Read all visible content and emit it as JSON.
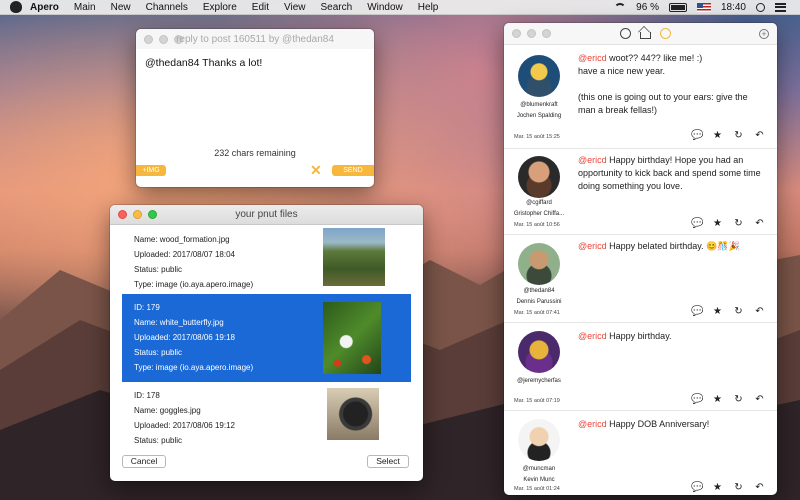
{
  "menubar": {
    "app": "Apero",
    "items": [
      "Main",
      "New",
      "Channels",
      "Explore",
      "Edit",
      "View",
      "Search",
      "Window",
      "Help"
    ],
    "battery": "96 %",
    "clock": "18:40"
  },
  "reply_window": {
    "title": "reply to post 160511 by @thedan84",
    "text": "@thedan84 Thanks a lot!",
    "chars_remaining": "232 chars remaining",
    "img_label": "+IMG",
    "cancel_glyph": "✕",
    "send_label": "SEND",
    "accent": "#f6b73c"
  },
  "files_window": {
    "title": "your pnut files",
    "files": [
      {
        "id": "",
        "name": "Name: wood_formation.jpg",
        "uploaded": "Uploaded: 2017/08/07 18:04",
        "status": "Status: public",
        "type": "Type: image (io.aya.apero.image)"
      },
      {
        "id": "ID: 179",
        "name": "Name: white_butterfly.jpg",
        "uploaded": "Uploaded: 2017/08/06 19:18",
        "status": "Status: public",
        "type": "Type: image (io.aya.apero.image)"
      },
      {
        "id": "ID: 178",
        "name": "Name: goggles.jpg",
        "uploaded": "Uploaded: 2017/08/06 19:12",
        "status": "Status: public",
        "type": ""
      }
    ],
    "selected_color": "#1a69d6",
    "cancel_label": "Cancel",
    "select_label": "Select"
  },
  "timeline": {
    "posts": [
      {
        "mention": "@ericd",
        "text": " woot?? 44?? like me! :)\nhave a nice new year.\n\n(this one is going out to your ears: give the man a break fellas!)",
        "username": "@blumenkraft",
        "fullname": "Jochen Spalding",
        "time": "Mar. 15 août 15:25"
      },
      {
        "mention": "@ericd",
        "text": " Happy birthday! Hope you had an opportunity to kick back and spend some time doing something you love.",
        "username": "@cgiffard",
        "fullname": "Gristopher Chiffa...",
        "time": "Mar. 15 août 10:56"
      },
      {
        "mention": "@ericd",
        "text": " Happy belated birthday. 😊🎊🎉",
        "username": "@thedan84",
        "fullname": "Dennis Parussini",
        "time": "Mar. 15 août 07:41"
      },
      {
        "mention": "@ericd",
        "text": " Happy birthday.",
        "username": "@jeremycherfas",
        "fullname": "",
        "time": "Mar. 15 août 07:19"
      },
      {
        "mention": "@ericd",
        "text": " Happy DOB Anniversary!",
        "username": "@muncman",
        "fullname": "Kevin Munc",
        "time": "Mar. 15 août 01:24"
      }
    ],
    "mention_color": "#e8473a",
    "action_icons": [
      "reply-bubble-icon",
      "star-icon",
      "repost-icon",
      "reply-arrow-icon"
    ]
  }
}
